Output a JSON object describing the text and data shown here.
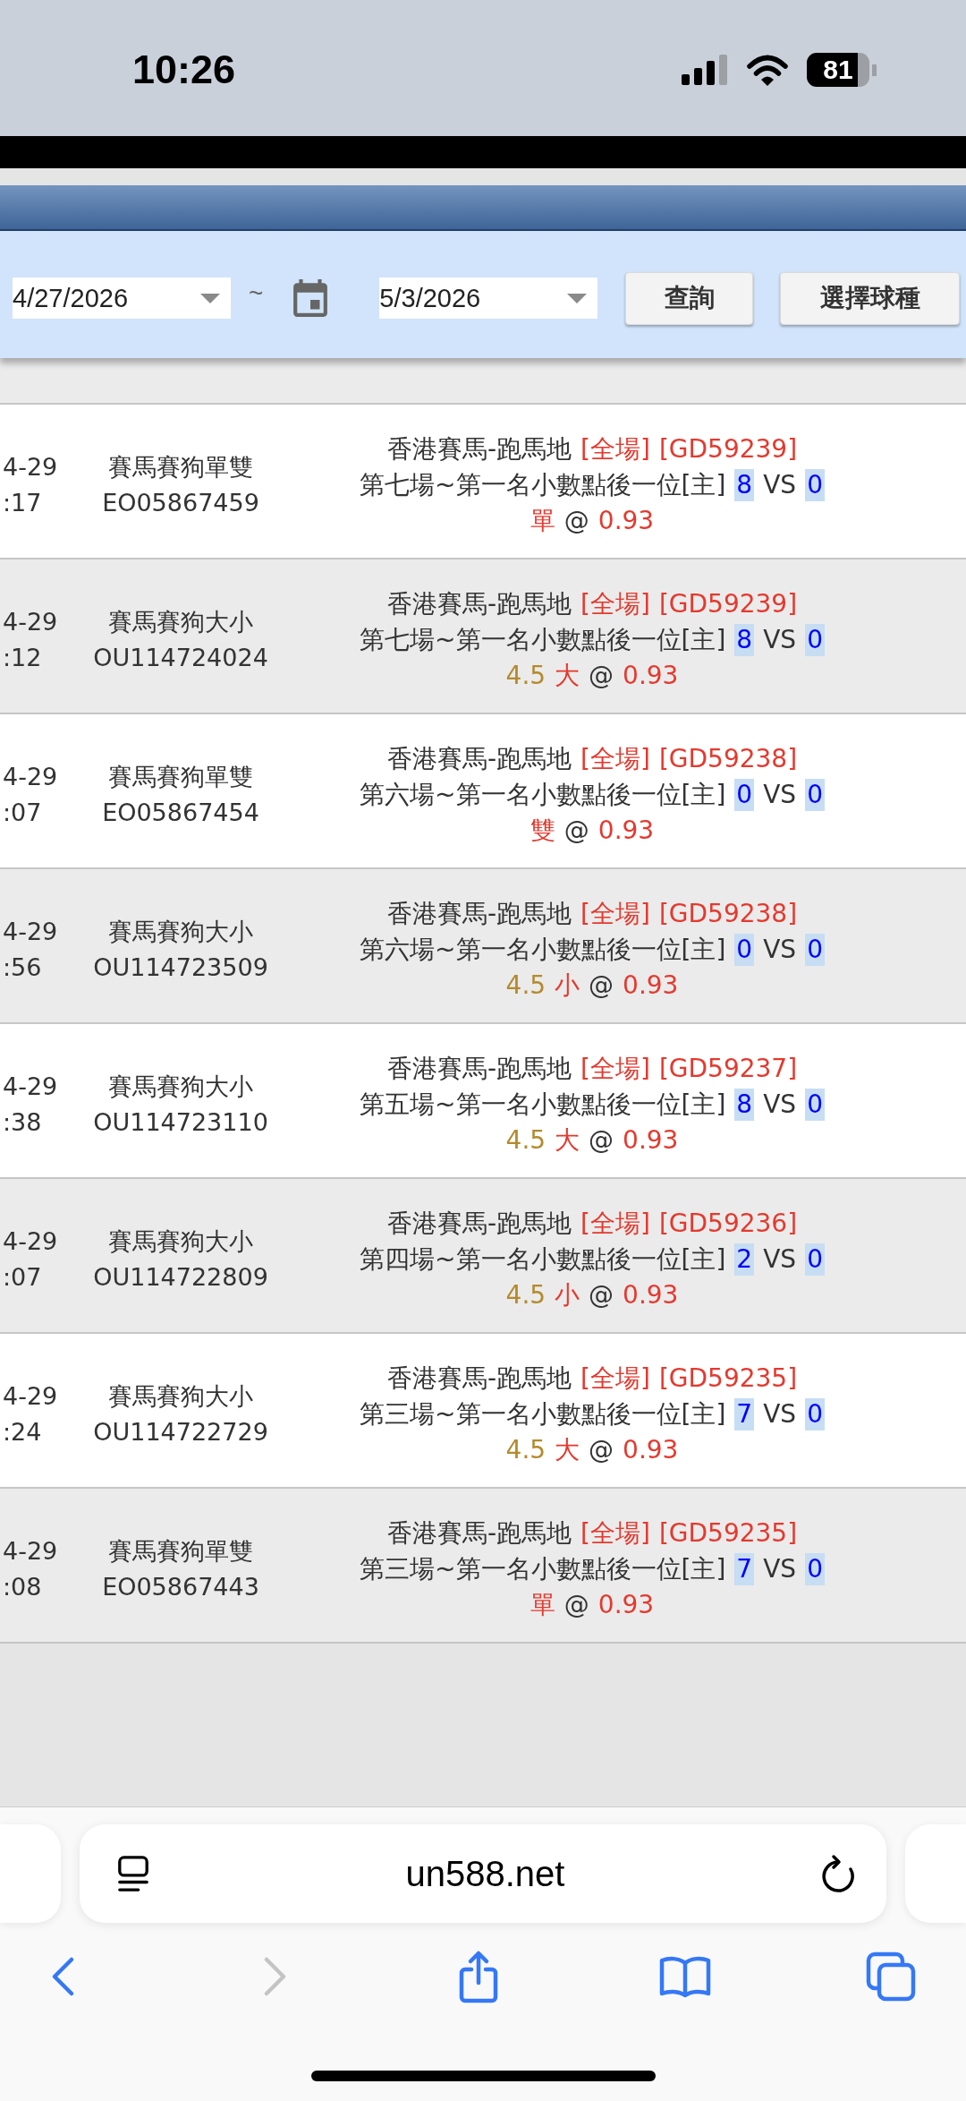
{
  "status_bar": {
    "time": "10:26",
    "battery": "81"
  },
  "filter": {
    "date_from": "4/27/2026",
    "separator": "~",
    "date_to": "5/3/2026",
    "buttons": [
      "查詢",
      "選擇球種"
    ]
  },
  "rows": [
    {
      "date": "4-29",
      "time": ":17",
      "bet_type": "賽馬賽狗單雙",
      "ticket": "EO05867459",
      "venue": "香港賽馬-跑馬地",
      "scope": "[全場]",
      "game_code": "[GD59239]",
      "race": "第七場~第一名小數點後一位[主]",
      "home": "8",
      "vs": "VS",
      "away": "0",
      "pick": "單",
      "at": "@",
      "odds": "0.93"
    },
    {
      "date": "4-29",
      "time": ":12",
      "bet_type": "賽馬賽狗大小",
      "ticket": "OU114724024",
      "venue": "香港賽馬-跑馬地",
      "scope": "[全場]",
      "game_code": "[GD59239]",
      "race": "第七場~第一名小數點後一位[主]",
      "home": "8",
      "vs": "VS",
      "away": "0",
      "line": "4.5",
      "pick": "大",
      "at": "@",
      "odds": "0.93"
    },
    {
      "date": "4-29",
      "time": ":07",
      "bet_type": "賽馬賽狗單雙",
      "ticket": "EO05867454",
      "venue": "香港賽馬-跑馬地",
      "scope": "[全場]",
      "game_code": "[GD59238]",
      "race": "第六場~第一名小數點後一位[主]",
      "home": "0",
      "vs": "VS",
      "away": "0",
      "pick": "雙",
      "at": "@",
      "odds": "0.93"
    },
    {
      "date": "4-29",
      "time": ":56",
      "bet_type": "賽馬賽狗大小",
      "ticket": "OU114723509",
      "venue": "香港賽馬-跑馬地",
      "scope": "[全場]",
      "game_code": "[GD59238]",
      "race": "第六場~第一名小數點後一位[主]",
      "home": "0",
      "vs": "VS",
      "away": "0",
      "line": "4.5",
      "pick": "小",
      "at": "@",
      "odds": "0.93"
    },
    {
      "date": "4-29",
      "time": ":38",
      "bet_type": "賽馬賽狗大小",
      "ticket": "OU114723110",
      "venue": "香港賽馬-跑馬地",
      "scope": "[全場]",
      "game_code": "[GD59237]",
      "race": "第五場~第一名小數點後一位[主]",
      "home": "8",
      "vs": "VS",
      "away": "0",
      "line": "4.5",
      "pick": "大",
      "at": "@",
      "odds": "0.93"
    },
    {
      "date": "4-29",
      "time": ":07",
      "bet_type": "賽馬賽狗大小",
      "ticket": "OU114722809",
      "venue": "香港賽馬-跑馬地",
      "scope": "[全場]",
      "game_code": "[GD59236]",
      "race": "第四場~第一名小數點後一位[主]",
      "home": "2",
      "vs": "VS",
      "away": "0",
      "line": "4.5",
      "pick": "小",
      "at": "@",
      "odds": "0.93"
    },
    {
      "date": "4-29",
      "time": ":24",
      "bet_type": "賽馬賽狗大小",
      "ticket": "OU114722729",
      "venue": "香港賽馬-跑馬地",
      "scope": "[全場]",
      "game_code": "[GD59235]",
      "race": "第三場~第一名小數點後一位[主]",
      "home": "7",
      "vs": "VS",
      "away": "0",
      "line": "4.5",
      "pick": "大",
      "at": "@",
      "odds": "0.93"
    },
    {
      "date": "4-29",
      "time": ":08",
      "bet_type": "賽馬賽狗單雙",
      "ticket": "EO05867443",
      "venue": "香港賽馬-跑馬地",
      "scope": "[全場]",
      "game_code": "[GD59235]",
      "race": "第三場~第一名小數點後一位[主]",
      "home": "7",
      "vs": "VS",
      "away": "0",
      "pick": "單",
      "at": "@",
      "odds": "0.93"
    }
  ],
  "browser": {
    "url": "un588.net",
    "toolbar": [
      {
        "kind": "back",
        "disabled": false
      },
      {
        "kind": "forward",
        "disabled": true
      },
      {
        "kind": "share",
        "disabled": false
      },
      {
        "kind": "bookmarks",
        "disabled": false
      },
      {
        "kind": "tabs",
        "disabled": false
      }
    ]
  }
}
